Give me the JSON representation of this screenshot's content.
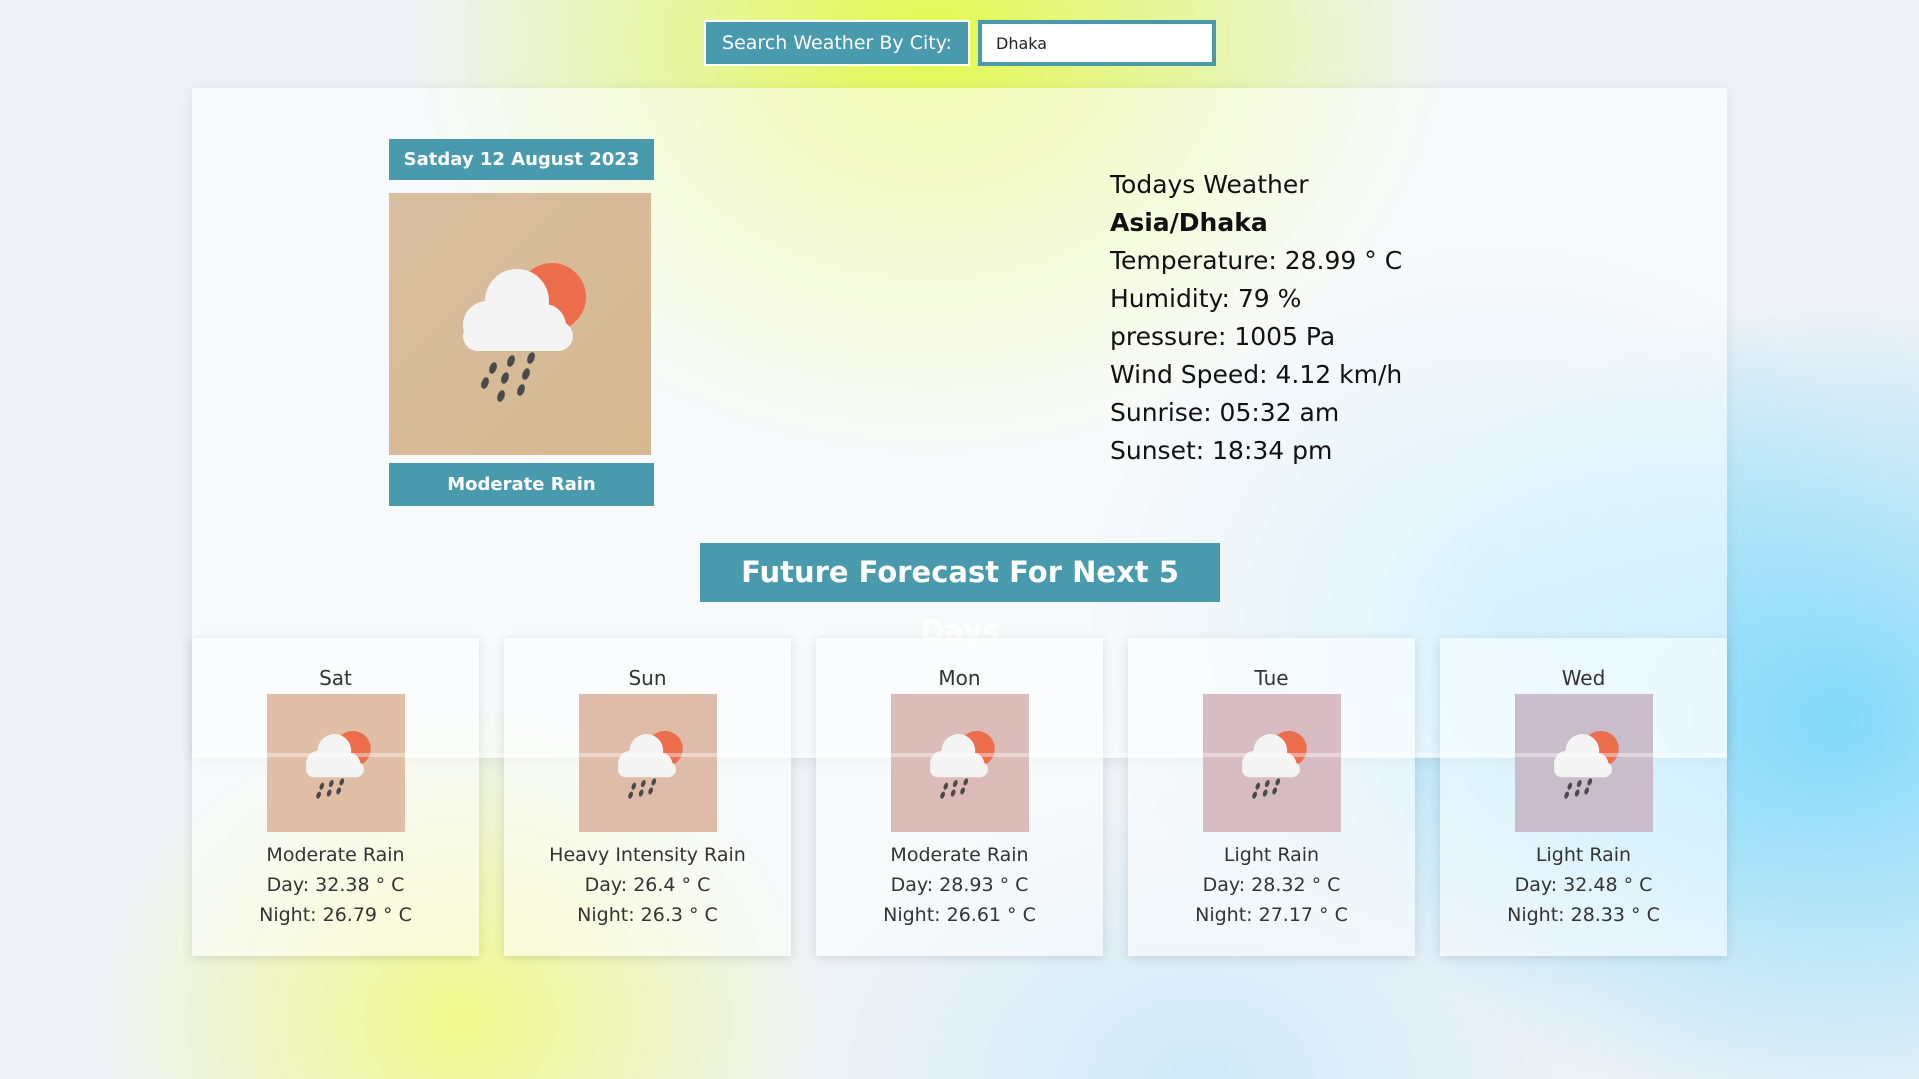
{
  "search": {
    "label": "Search Weather By City:",
    "value": "Dhaka"
  },
  "today": {
    "date": "Satday 12 August 2023",
    "condition": "Moderate Rain",
    "icon": "cloud-rain-sun-icon",
    "heading": "Todays Weather",
    "city": "Asia/Dhaka",
    "temperature": "Temperature: 28.99 ° C",
    "humidity": "Humidity: 79 %",
    "pressure": "pressure: 1005 Pa",
    "wind": "Wind Speed: 4.12 km/h",
    "sunrise": "Sunrise: 05:32 am",
    "sunset": "Sunset: 18:34 pm"
  },
  "forecast_title": "Future Forecast For Next 5 Days",
  "forecast": [
    {
      "day": "Sat",
      "condition": "Moderate Rain",
      "day_temp": "Day: 32.38 ° C",
      "night_temp": "Night: 26.79 ° C",
      "icon": "cloud-rain-sun-icon"
    },
    {
      "day": "Sun",
      "condition": "Heavy Intensity Rain",
      "day_temp": "Day: 26.4 ° C",
      "night_temp": "Night: 26.3 ° C",
      "icon": "cloud-rain-sun-icon"
    },
    {
      "day": "Mon",
      "condition": "Moderate Rain",
      "day_temp": "Day: 28.93 ° C",
      "night_temp": "Night: 26.61 ° C",
      "icon": "cloud-rain-sun-icon"
    },
    {
      "day": "Tue",
      "condition": "Light Rain",
      "day_temp": "Day: 28.32 ° C",
      "night_temp": "Night: 27.17 ° C",
      "icon": "cloud-rain-sun-icon"
    },
    {
      "day": "Wed",
      "condition": "Light Rain",
      "day_temp": "Day: 32.48 ° C",
      "night_temp": "Night: 28.33 ° C",
      "icon": "cloud-rain-sun-icon"
    }
  ],
  "colors": {
    "accent": "#4a9aae",
    "sun": "#ec6e4c",
    "cloud": "#f4f4f4",
    "rain": "#4a4a4a"
  }
}
